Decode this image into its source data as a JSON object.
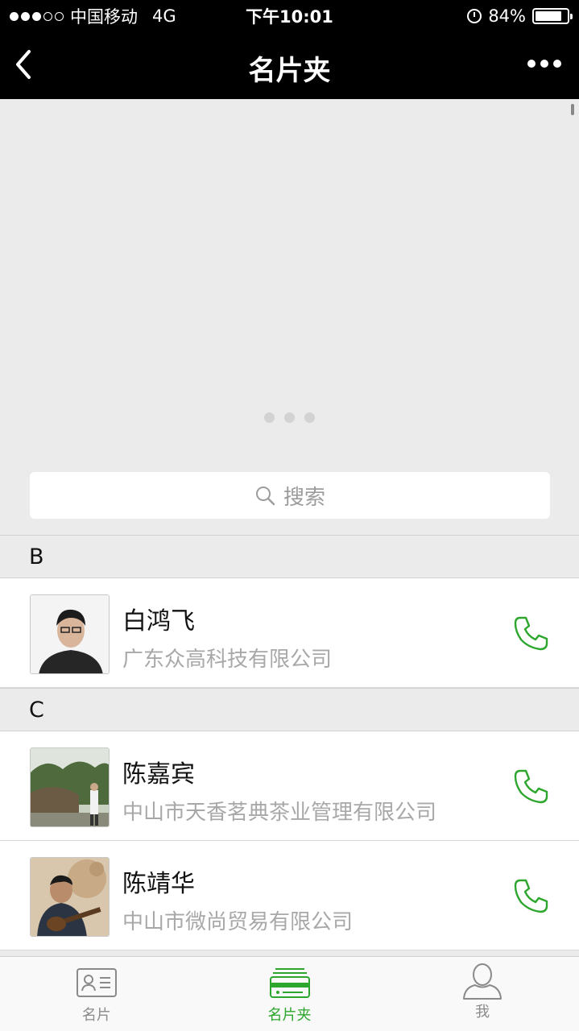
{
  "status_bar": {
    "carrier": "中国移动",
    "network": "4G",
    "time": "下午10:01",
    "battery": "84%",
    "battery_level": 0.84
  },
  "nav": {
    "title": "名片夹",
    "back_icon": "chevron-left-icon",
    "more_icon": "more-dots-icon"
  },
  "search": {
    "placeholder": "搜索",
    "icon": "search-icon"
  },
  "sections": [
    {
      "letter": "B",
      "contacts": [
        {
          "name": "白鸿飞",
          "company": "广东众高科技有限公司"
        }
      ]
    },
    {
      "letter": "C",
      "contacts": [
        {
          "name": "陈嘉宾",
          "company": "中山市天香茗典茶业管理有限公司"
        },
        {
          "name": "陈靖华",
          "company": "中山市微尚贸易有限公司"
        }
      ]
    }
  ],
  "tabs": [
    {
      "label": "名片",
      "icon": "card-icon",
      "active": false
    },
    {
      "label": "名片夹",
      "icon": "card-folder-icon",
      "active": true
    },
    {
      "label": "我",
      "icon": "person-icon",
      "active": false
    }
  ],
  "colors": {
    "accent": "#2ca62c",
    "header_bg": "#000000",
    "background": "#ebebeb"
  }
}
